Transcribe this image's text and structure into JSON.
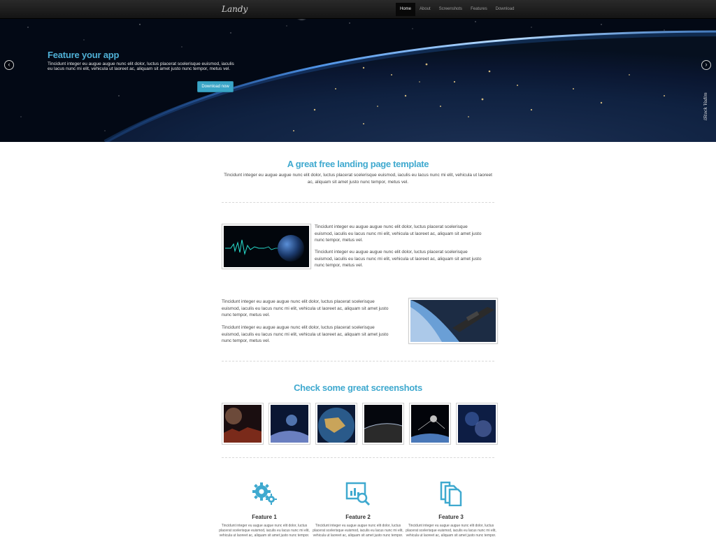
{
  "nav": {
    "brand": "Landy",
    "links": [
      "Home",
      "About",
      "Screenshots",
      "Features",
      "Download"
    ],
    "active": "Home"
  },
  "hero": {
    "title": "Feature your app",
    "text": "Tincidunt integer eu augue augue nunc elit dolor, luctus placerat scelerisque euismod, iaculis eu lacus nunc mi elit, vehicula ut laoreet ac, aliquam sit amet justo nunc tempor, metus vel.",
    "button": "Download now",
    "credit": "iStock Vadim"
  },
  "intro": {
    "title": "A great free landing page template",
    "text": "Tincidunt integer eu augue augue nunc elit dolor, luctus placerat scelerisque euismod, iaculis eu lacus nunc mi elit, vehicula ut laoreet ac, aliquam sit amet justo nunc tempor, metus vel."
  },
  "block1": {
    "p1": "Tincidunt integer eu augue augue nunc elit dolor, luctus placerat scelerisque euismod, iaculis eu lacus nunc mi elit, vehicula ut laoreet ac, aliquam sit amet justo nunc tempor, metus vel.",
    "p2": "Tincidunt integer eu augue augue nunc elit dolor, luctus placerat scelerisque euismod, iaculis eu lacus nunc mi elit, vehicula ut laoreet ac, aliquam sit amet justo nunc tempor, metus vel."
  },
  "block2": {
    "p1": "Tincidunt integer eu augue augue nunc elit dolor, luctus placerat scelerisque euismod, iaculis eu lacus nunc mi elit, vehicula ut laoreet ac, aliquam sit amet justo nunc tempor, metus vel.",
    "p2": "Tincidunt integer eu augue augue nunc elit dolor, luctus placerat scelerisque euismod, iaculis eu lacus nunc mi elit, vehicula ut laoreet ac, aliquam sit amet justo nunc tempor, metus vel."
  },
  "screenshots": {
    "title": "Check some great screenshots"
  },
  "features": [
    {
      "title": "Feature 1",
      "icon": "gears-icon",
      "text": "Tincidunt integer eu augue augue nunc elit dolor, luctus placerat scelerisque euismod, iaculis eu lacus nunc mi elit, vehicula ut laoreet ac, aliquam sit amet justo nunc tempor."
    },
    {
      "title": "Feature 2",
      "icon": "analytics-search-icon",
      "text": "Tincidunt integer eu augue augue nunc elit dolor, luctus placerat scelerisque euismod, iaculis eu lacus nunc mi elit, vehicula ut laoreet ac, aliquam sit amet justo nunc tempor."
    },
    {
      "title": "Feature 3",
      "icon": "copy-documents-icon",
      "text": "Tincidunt integer eu augue augue nunc elit dolor, luctus placerat scelerisque euismod, iaculis eu lacus nunc mi elit, vehicula ut laoreet ac, aliquam sit amet justo nunc tempor."
    }
  ],
  "colors": {
    "accent": "#3fa9cf",
    "button": "#3aa5c7",
    "nav_bg": "#1e1e1e"
  }
}
